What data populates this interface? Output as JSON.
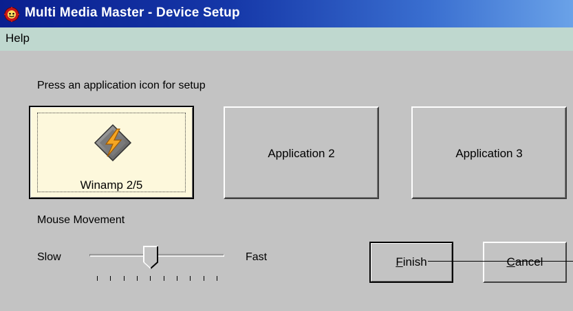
{
  "window": {
    "title": "Multi Media Master - Device Setup",
    "icon": "red-gear-icon"
  },
  "menu": {
    "items": [
      {
        "label": "Help"
      }
    ]
  },
  "setup": {
    "instruction": "Press an application icon for setup",
    "applications": [
      {
        "label": "Winamp 2/5",
        "icon": "winamp-lightning-icon",
        "selected": true
      },
      {
        "label": "Application 2",
        "selected": false
      },
      {
        "label": "Application 3",
        "selected": false
      }
    ]
  },
  "mouse_movement": {
    "label": "Mouse Movement",
    "min_label": "Slow",
    "max_label": "Fast",
    "value_fraction": 0.45,
    "tick_count": 10
  },
  "buttons": {
    "finish": {
      "accel": "F",
      "rest": "inish"
    },
    "cancel": {
      "accel": "C",
      "rest": "ancel"
    }
  },
  "colors": {
    "title_gradient_start": "#0a1f8f",
    "title_gradient_end": "#6aa2e8",
    "menubar": "#bfd8cf",
    "selected_app_background": "#fdf8dc",
    "dialog_background": "#c3c3c3"
  }
}
